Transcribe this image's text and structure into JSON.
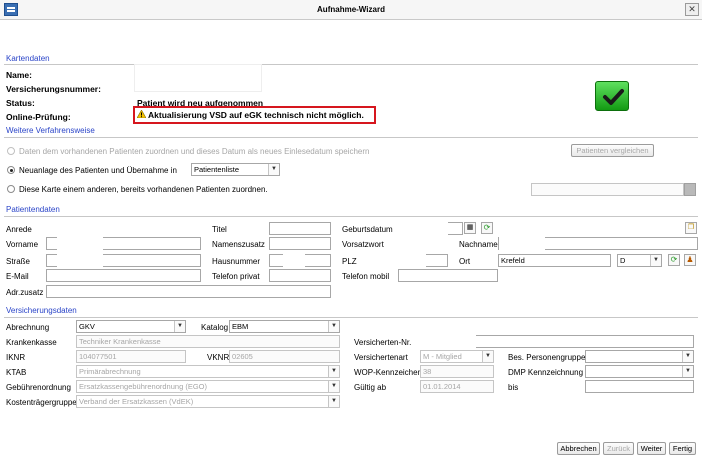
{
  "window": {
    "title": "Aufnahme-Wizard",
    "close": "✕"
  },
  "kartendaten": {
    "heading": "Kartendaten",
    "name_label": "Name:",
    "vn_label": "Versicherungsnummer:",
    "status_label": "Status:",
    "status_value": "Patient wird neu aufgenommen",
    "online_label": "Online-Prüfung:",
    "online_value": "Aktualisierung VSD auf eGK technisch nicht möglich."
  },
  "weitere": {
    "heading": "Weitere Verfahrensweise",
    "opt1": "Daten dem vorhandenen Patienten zuordnen und dieses Datum als neues Einlesedatum speichern",
    "opt1_button": "Patienten vergleichen",
    "opt2": "Neuanlage des Patienten und Übernahme in",
    "opt2_select": "Patientenliste",
    "opt3": "Diese Karte einem anderen, bereits vorhandenen Patienten zuordnen."
  },
  "patientendaten": {
    "heading": "Patientendaten",
    "anrede": "Anrede",
    "titel": "Titel",
    "geburtsdatum": "Geburtsdatum",
    "vorname": "Vorname",
    "namenszusatz": "Namenszusatz",
    "vorsatzwort": "Vorsatzwort",
    "nachname": "Nachname",
    "strasse": "Straße",
    "hausnummer": "Hausnummer",
    "plz": "PLZ",
    "ort": "Ort",
    "ort_value": "Krefeld",
    "land_value": "D",
    "email": "E-Mail",
    "telefon_privat": "Telefon privat",
    "telefon_mobil": "Telefon mobil",
    "adr_zusatz": "Adr.zusatz"
  },
  "versicherungsdaten": {
    "heading": "Versicherungsdaten",
    "abrechnung": "Abrechnung",
    "abrechnung_value": "GKV",
    "katalog": "Katalog",
    "katalog_value": "EBM",
    "krankenkasse": "Krankenkasse",
    "krankenkasse_value": "Techniker Krankenkasse",
    "versicherten_nr": "Versicherten-Nr.",
    "iknr": "IKNR",
    "iknr_value": "104077501",
    "vknr": "VKNR",
    "vknr_value": "02605",
    "versichertenart": "Versichertenart",
    "versichertenart_value": "M - Mitglied",
    "bes_personengruppe": "Bes. Personengruppe",
    "ktab": "KTAB",
    "ktab_value": "Primärabrechnung",
    "wop": "WOP-Kennzeichen",
    "wop_value": "38",
    "dmp": "DMP Kennzeichnung",
    "gebuehrenordnung": "Gebührenordnung",
    "gebuehrenordnung_value": "Ersatzkassengebührenordnung (EGO)",
    "gueltig_ab": "Gültig ab",
    "gueltig_ab_value": "01.01.2014",
    "bis": "bis",
    "kostentraeger": "Kostenträgergruppe",
    "kostentraeger_value": "Verband der Ersatzkassen (VdEK)"
  },
  "buttons": {
    "abbrechen": "Abbrechen",
    "zurueck": "Zurück",
    "weiter": "Weiter",
    "fertig": "Fertig"
  },
  "icons": {
    "warning": "warning-icon",
    "checkmark": "checkmark-icon",
    "calendar": "calendar-icon",
    "refresh": "refresh-icon",
    "copy": "copy-icon",
    "person": "person-icon"
  },
  "colors": {
    "section_heading": "#2a44c8",
    "warning_border": "#d6161e",
    "ok_green": "#139a13"
  }
}
